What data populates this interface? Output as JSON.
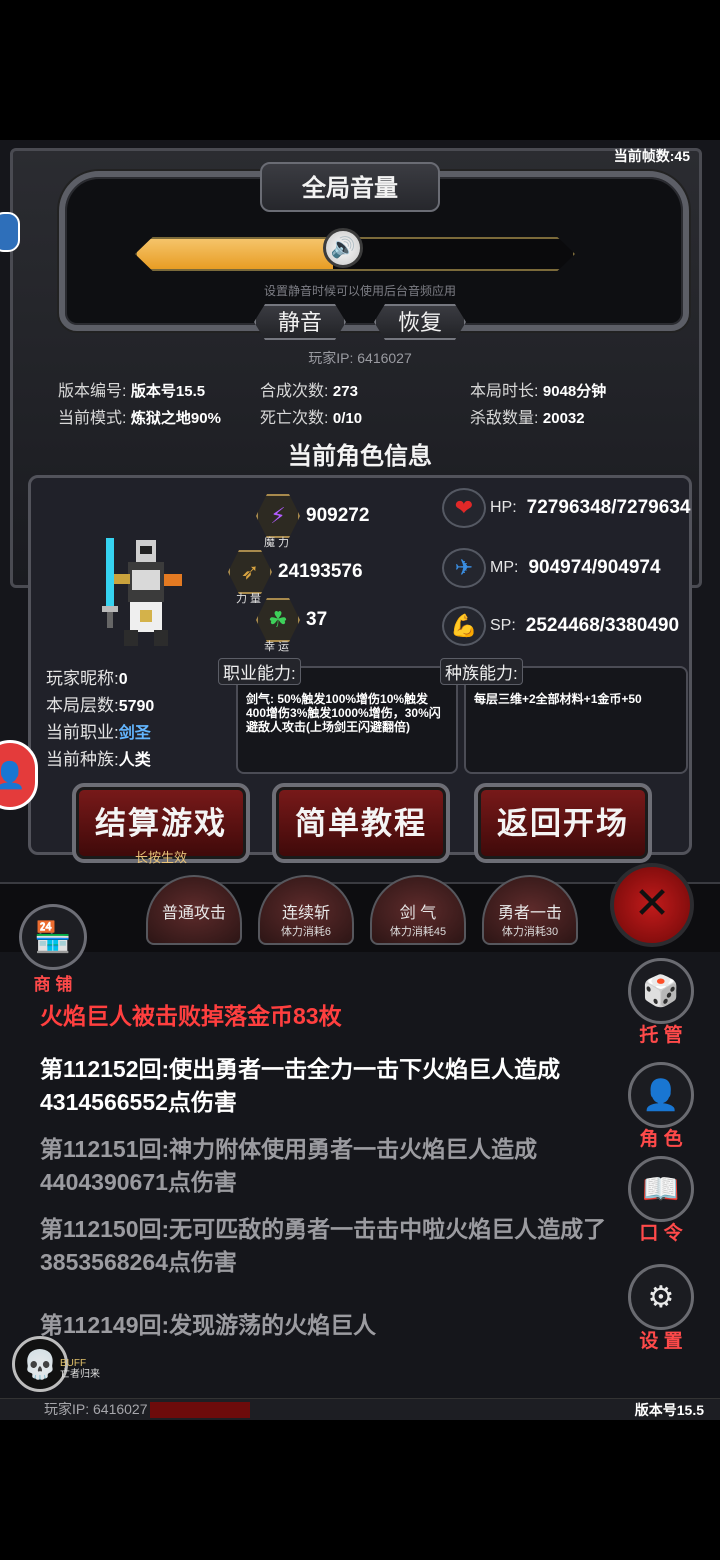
{
  "fps": "当前帧数:45",
  "volume": {
    "title": "全局音量",
    "level": 0.45,
    "hint": "设置静音时候可以使用后台音频应用",
    "mute_label": "静音",
    "restore_label": "恢复",
    "knob_icon": "speaker-icon"
  },
  "player_ip": "玩家IP: 6416027",
  "stats": {
    "version_label": "版本编号:",
    "version_value": "版本号15.5",
    "mode_label": "当前模式:",
    "mode_value": "炼狱之地90%",
    "merge_label": "合成次数:",
    "merge_value": "273",
    "death_label": "死亡次数:",
    "death_value": "0/10",
    "time_label": "本局时长:",
    "time_value": "9048分钟",
    "kills_label": "杀敌数量:",
    "kills_value": "20032"
  },
  "section_title": "当前角色信息",
  "attributes": {
    "magic": {
      "value": "909272",
      "caption": "魔 力"
    },
    "strength": {
      "value": "24193576",
      "caption": "力 量"
    },
    "luck": {
      "value": "37",
      "caption": "幸 运"
    }
  },
  "resources": {
    "hp": {
      "label": "HP:",
      "value": "72796348/7279634"
    },
    "mp": {
      "label": "MP:",
      "value": "904974/904974"
    },
    "sp": {
      "label": "SP:",
      "value": "2524468/3380490"
    }
  },
  "info": {
    "nickname_label": "玩家昵称:",
    "nickname_value": "0",
    "floor_label": "本局层数:",
    "floor_value": "5790",
    "class_label": "当前职业:",
    "class_value": "剑圣",
    "race_label": "当前种族:",
    "race_value": "人类"
  },
  "abilities": {
    "class_tag": "职业能力:",
    "class_text": "剑气: 50%触发100%增伤10%触发400增伤3%触发1000%增伤，30%闪避敌人攻击(上场剑王闪避翻倍)",
    "race_tag": "种族能力:",
    "race_text": "每层三维+2全部材料+1金币+50"
  },
  "buttons": {
    "settle": "结算游戏",
    "settle_sub": "长按生效",
    "tutorial": "简单教程",
    "back": "返回开场"
  },
  "skills": [
    {
      "name": "普通攻击",
      "cost": ""
    },
    {
      "name": "连续斩",
      "cost": "体力消耗6"
    },
    {
      "name": "剑 气",
      "cost": "体力消耗45"
    },
    {
      "name": "勇者一击",
      "cost": "体力消耗30"
    }
  ],
  "shop_label": "商 铺",
  "log": [
    "火焰巨人被击败掉落金币83枚",
    "第112152回:使出勇者一击全力一击下火焰巨人造成4314566552点伤害",
    "第112151回:神力附体使用勇者一击火焰巨人造成4404390671点伤害",
    "第112150回:无可匹敌的勇者一击击中啦火焰巨人造成了3853568264点伤害",
    "第112149回:发现游荡的火焰巨人"
  ],
  "right_menu": {
    "auto": "托 管",
    "role": "角 色",
    "code": "口 令",
    "settings": "设 置"
  },
  "buff": {
    "title": "BUFF",
    "name": "亡者归来"
  },
  "footer": {
    "ip": "玩家IP: 6416027",
    "version": "版本号15.5"
  }
}
